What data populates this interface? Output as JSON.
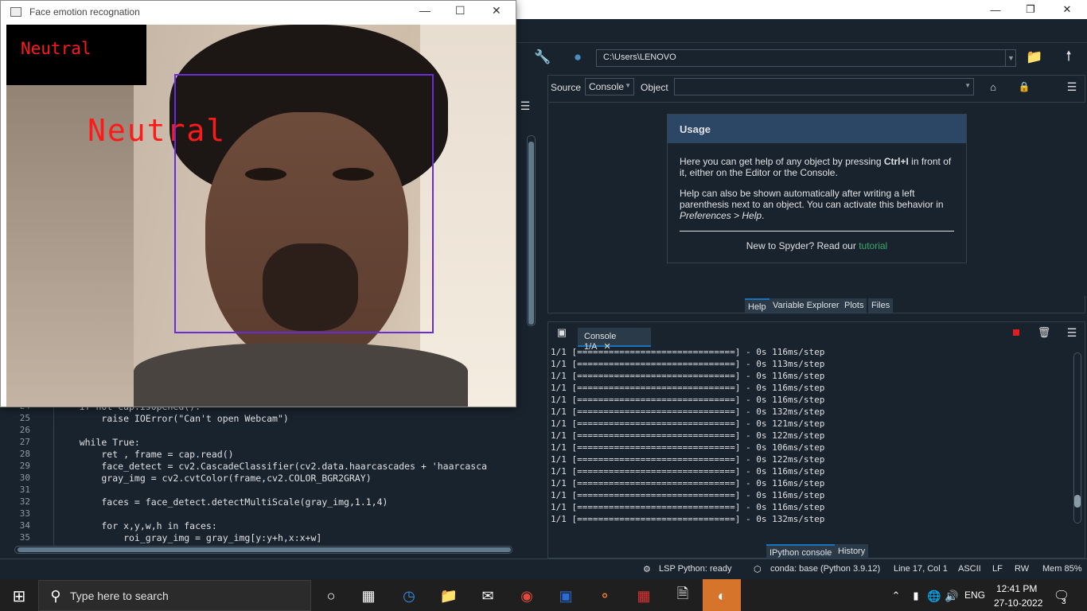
{
  "cv_window": {
    "title": "Face emotion recognation",
    "label_top": "Neutral",
    "label_face": "Neutral"
  },
  "toolbar": {
    "path": "C:\\Users\\LENOVO"
  },
  "help": {
    "source_label": "Source",
    "source_value": "Console",
    "object_label": "Object",
    "usage_title": "Usage",
    "usage_p1_a": "Here you can get help of any object by pressing ",
    "usage_p1_b": "Ctrl+I",
    "usage_p1_c": " in front of it, either on the Editor or the Console.",
    "usage_p2_a": "Help can also be shown automatically after writing a left parenthesis next to an object. You can activate this behavior in ",
    "usage_p2_b": "Preferences > Help",
    "usage_p2_c": ".",
    "footer_a": "New to Spyder? Read our ",
    "footer_link": "tutorial",
    "tabs": [
      "Help",
      "Variable Explorer",
      "Plots",
      "Files"
    ]
  },
  "console": {
    "tab_label": "Console 1/A",
    "lines": [
      "1/1 [==============================] - 0s 116ms/step",
      "1/1 [==============================] - 0s 113ms/step",
      "1/1 [==============================] - 0s 116ms/step",
      "1/1 [==============================] - 0s 116ms/step",
      "1/1 [==============================] - 0s 116ms/step",
      "1/1 [==============================] - 0s 132ms/step",
      "1/1 [==============================] - 0s 121ms/step",
      "1/1 [==============================] - 0s 122ms/step",
      "1/1 [==============================] - 0s 106ms/step",
      "1/1 [==============================] - 0s 122ms/step",
      "1/1 [==============================] - 0s 116ms/step",
      "1/1 [==============================] - 0s 116ms/step",
      "1/1 [==============================] - 0s 116ms/step",
      "1/1 [==============================] - 0s 116ms/step",
      "1/1 [==============================] - 0s 132ms/step"
    ],
    "tabs": [
      "IPython console",
      "History"
    ]
  },
  "editor": {
    "lines": [
      {
        "n": "24",
        "code": "    if not cap.isOpened():"
      },
      {
        "n": "25",
        "code": "        raise IOError(\"Can't open Webcam\")"
      },
      {
        "n": "26",
        "code": ""
      },
      {
        "n": "27",
        "code": "    while True:"
      },
      {
        "n": "28",
        "code": "        ret , frame = cap.read()"
      },
      {
        "n": "29",
        "code": "        face_detect = cv2.CascadeClassifier(cv2.data.haarcascades + 'haarcasca"
      },
      {
        "n": "30",
        "code": "        gray_img = cv2.cvtColor(frame,cv2.COLOR_BGR2GRAY)"
      },
      {
        "n": "31",
        "code": ""
      },
      {
        "n": "32",
        "code": "        faces = face_detect.detectMultiScale(gray_img,1.1,4)"
      },
      {
        "n": "33",
        "code": ""
      },
      {
        "n": "34",
        "code": "        for x,y,w,h in faces:"
      },
      {
        "n": "35",
        "code": "            roi_gray_img = gray_img[y:y+h,x:x+w]"
      }
    ]
  },
  "status": {
    "lsp": "LSP Python: ready",
    "conda": "conda: base (Python 3.9.12)",
    "position": "Line 17, Col 1",
    "encoding": "ASCII",
    "eol": "LF",
    "rw": "RW",
    "mem": "Mem 85%"
  },
  "taskbar": {
    "search_placeholder": "Type here to search",
    "lang": "ENG",
    "time": "12:41 PM",
    "date": "27-10-2022",
    "notif_count": "3"
  }
}
